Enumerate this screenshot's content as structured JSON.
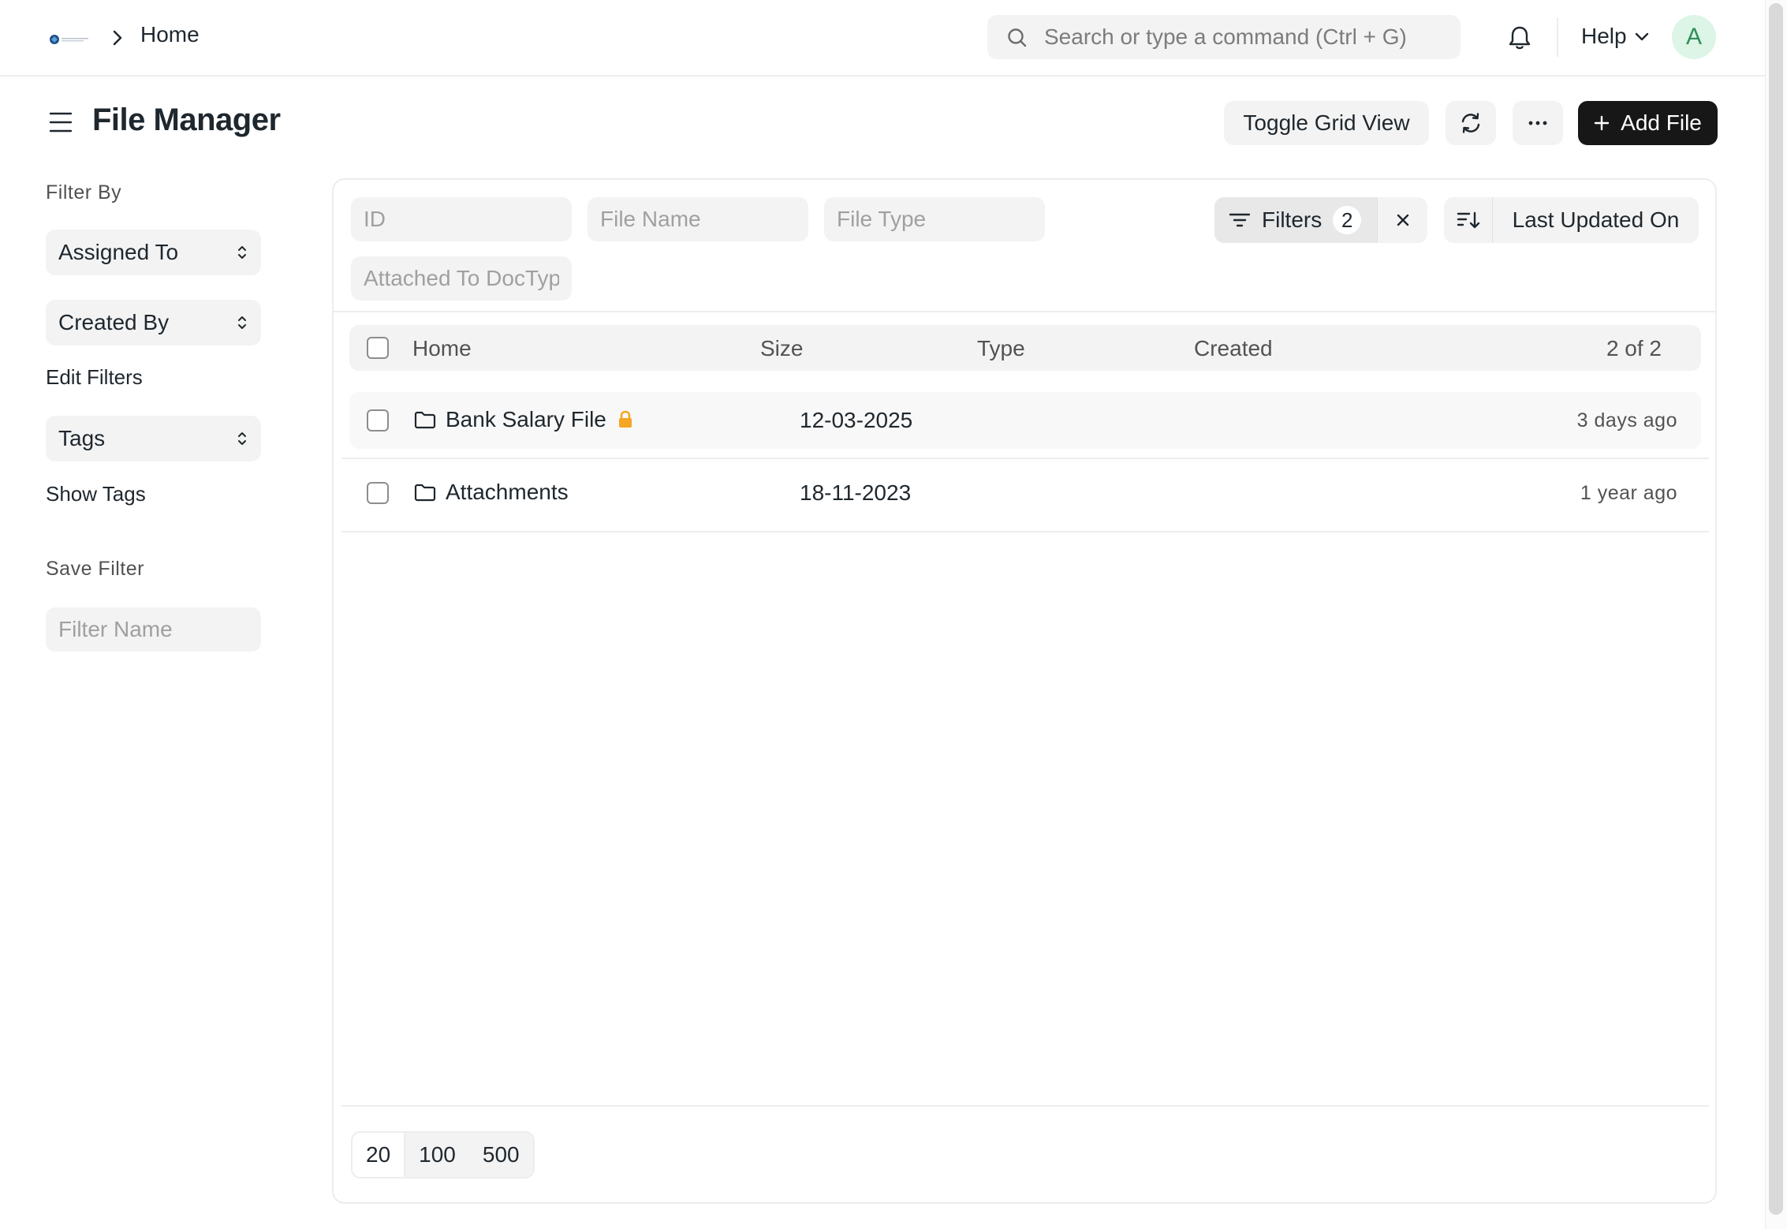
{
  "navbar": {
    "breadcrumb": "Home",
    "search_placeholder": "Search or type a command (Ctrl + G)",
    "help_label": "Help",
    "avatar_initial": "A"
  },
  "page": {
    "title": "File Manager",
    "toggle_grid_label": "Toggle Grid View",
    "add_file_label": "Add File"
  },
  "sidebar": {
    "filter_by_label": "Filter By",
    "assigned_to_label": "Assigned To",
    "created_by_label": "Created By",
    "edit_filters_label": "Edit Filters",
    "tags_label": "Tags",
    "show_tags_label": "Show Tags",
    "save_filter_label": "Save Filter",
    "filter_name_placeholder": "Filter Name"
  },
  "filters": {
    "id_placeholder": "ID",
    "file_name_placeholder": "File Name",
    "file_type_placeholder": "File Type",
    "attached_to_placeholder": "Attached To DocType",
    "filters_label": "Filters",
    "filters_count": "2",
    "sort_label": "Last Updated On"
  },
  "table": {
    "columns": {
      "name": "Home",
      "size": "Size",
      "type": "Type",
      "created": "Created"
    },
    "count_label": "2 of 2",
    "rows": [
      {
        "name": "Bank Salary File",
        "created": "12-03-2025",
        "modified": "3 days ago",
        "private": true
      },
      {
        "name": "Attachments",
        "created": "18-11-2023",
        "modified": "1 year ago",
        "private": false
      }
    ]
  },
  "paging": {
    "options": [
      "20",
      "100",
      "500"
    ],
    "selected": "20"
  },
  "colors": {
    "primary_button": "#171717",
    "lock_icon": "#f5a623",
    "avatar_bg": "#dcf5e6",
    "avatar_text": "#2f8f59"
  }
}
